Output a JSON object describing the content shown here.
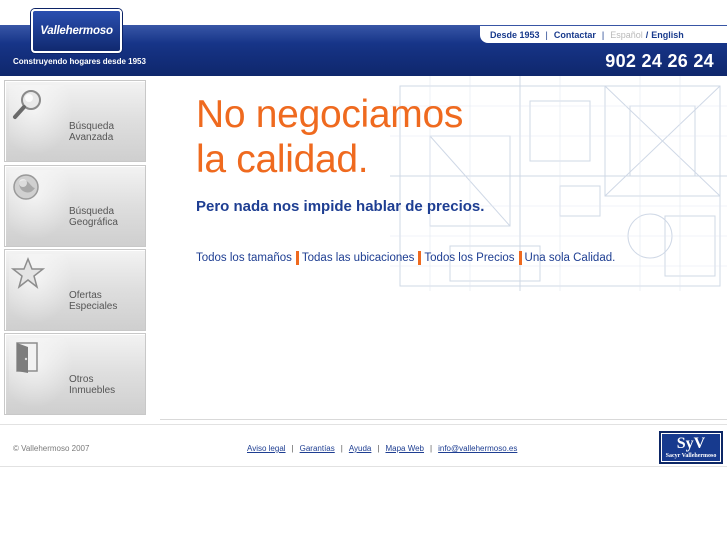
{
  "header": {
    "logo_text": "Vallehermoso",
    "tagline": "Construyendo hogares desde 1953",
    "phone": "902 24 26 24",
    "nav": {
      "since": "Desde 1953",
      "contact": "Contactar",
      "lang_es": "Español",
      "lang_en": "English"
    }
  },
  "sidebar": {
    "items": [
      {
        "line1": "Búsqueda",
        "line2": "Avanzada",
        "icon": "magnifier-icon"
      },
      {
        "line1": "Búsqueda",
        "line2": "Geográfica",
        "icon": "globe-icon"
      },
      {
        "line1": "Ofertas",
        "line2": "Especiales",
        "icon": "star-icon"
      },
      {
        "line1": "Otros",
        "line2": "Inmuebles",
        "icon": "door-icon"
      }
    ]
  },
  "main": {
    "headline_line1": "No negociamos",
    "headline_line2": "la calidad.",
    "subheadline": "Pero nada nos impide hablar de precios.",
    "features": [
      "Todos los tamaños",
      "Todas las ubicaciones",
      "Todos los Precios",
      "Una sola Calidad."
    ]
  },
  "footer": {
    "copyright": "© Vallehermoso 2007",
    "links": [
      "Aviso legal",
      "Garantías",
      "Ayuda",
      "Mapa Web",
      "info@vallehermoso.es"
    ],
    "badge_big": "SyV",
    "badge_small": "Sacyr Vallehermoso"
  },
  "colors": {
    "brand_blue": "#1e3e92",
    "accent_orange": "#ef6a1f"
  }
}
